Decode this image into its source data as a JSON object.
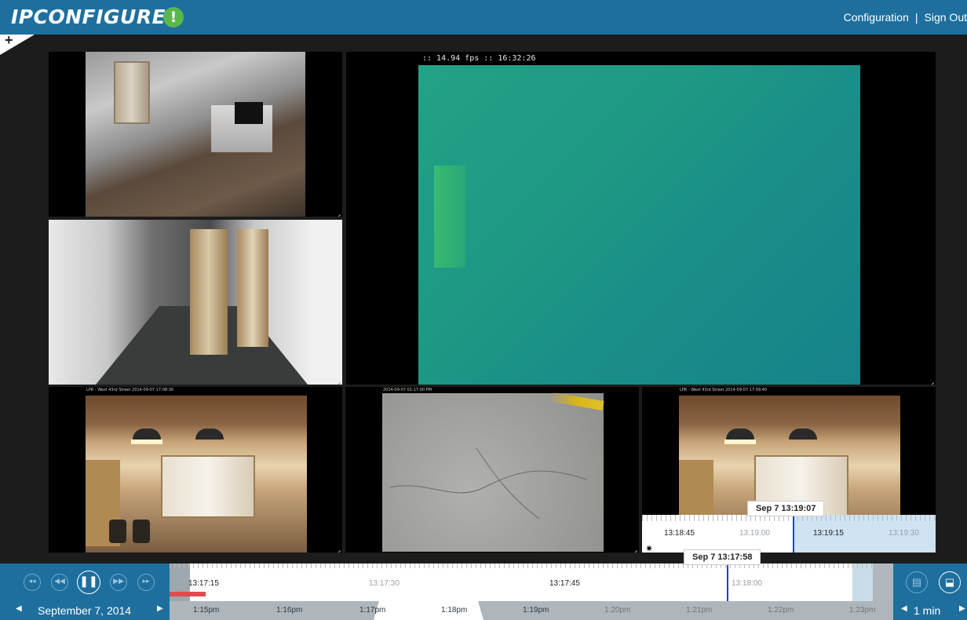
{
  "header": {
    "logo": "IPCONFIGURE",
    "alert_glyph": "!",
    "configuration_link": "Configuration",
    "separator": "|",
    "sign_out_link": "Sign Out"
  },
  "add_button_glyph": "+",
  "main_camera": {
    "overlay": ":: 14.94 fps :: 16:32:26"
  },
  "camera_timestamps": {
    "cam4": "LPR - West 43rd Street  2014-09-07 17:08:30",
    "cam5": "2014-09-07 01:17:00 PM",
    "cam6": "LPR - West 43rd Street  2014-09-07 17:09:40"
  },
  "preview_timeline": {
    "tooltip": "Sep 7 13:19:07",
    "labels": [
      "13:18:45",
      "13:19:00",
      "13:19:15",
      "13:19:30"
    ]
  },
  "playback_controls": {
    "skip_back_glyph": "◂◂",
    "rewind_glyph": "◀◀",
    "pause_glyph": "❚❚",
    "fast_forward_glyph": "▶▶",
    "skip_forward_glyph": "▸▸"
  },
  "timeline": {
    "tooltip": "Sep 7 13:17:58",
    "labels": [
      "13:17:15",
      "13:17:30",
      "13:17:45",
      "13:18:00"
    ]
  },
  "date_nav": {
    "prev_glyph": "◀",
    "date": "September 7, 2014",
    "next_glyph": "▶"
  },
  "hour_labels": [
    "1:15pm",
    "1:16pm",
    "1:17pm",
    "1:18pm",
    "1:19pm",
    "1:20pm",
    "1:21pm",
    "1:22pm",
    "1:23pm"
  ],
  "zoom": {
    "prev_glyph": "◀",
    "value": "1 min",
    "next_glyph": "▶"
  },
  "right_controls": {
    "layout_glyph": "▤",
    "export_glyph": "⬓"
  },
  "colors": {
    "header_bg": "#1e6f9e",
    "alert_green": "#5ab84a",
    "cursor_blue": "#1f3fd6",
    "recording_red": "#e04b4b"
  }
}
